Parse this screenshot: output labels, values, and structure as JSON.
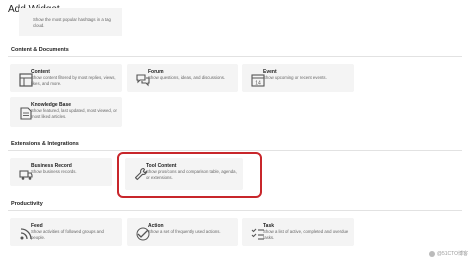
{
  "dialog": {
    "title": "Add Widget"
  },
  "top_partial": {
    "desc": "Show the most popular hashtags in a tag cloud."
  },
  "sections": {
    "content": {
      "label": "Content & Documents"
    },
    "extensions": {
      "label": "Extensions & Integrations"
    },
    "productivity": {
      "label": "Productivity"
    }
  },
  "widgets": {
    "content": {
      "title": "Content",
      "desc": "Show content filtered by most replies, views, likes, and more.",
      "icon": "content-icon"
    },
    "forum": {
      "title": "Forum",
      "desc": "Show questions, ideas, and discussions.",
      "icon": "forum-icon"
    },
    "event": {
      "title": "Event",
      "desc": "Show upcoming or recent events.",
      "icon": "calendar-icon",
      "icon_text": "14"
    },
    "knowledge": {
      "title": "Knowledge Base",
      "desc": "Show featured, last updated, most viewed, or most liked articles.",
      "icon": "book-icon"
    },
    "business": {
      "title": "Business Record",
      "desc": "Show business records.",
      "icon": "truck-icon"
    },
    "tool": {
      "title": "Tool Content",
      "desc": "Show pros/cons and comparison table, agenda, or extensions.",
      "icon": "wrench-icon"
    },
    "feed": {
      "title": "Feed",
      "desc": "Show activities of followed groups and people.",
      "icon": "feed-icon"
    },
    "action": {
      "title": "Action",
      "desc": "Show a set of frequently used actions.",
      "icon": "action-icon"
    },
    "task": {
      "title": "Task",
      "desc": "Show a list of active, completed and overdue tasks.",
      "icon": "task-icon"
    }
  },
  "watermark": {
    "text": "@51CTO博客"
  },
  "colors": {
    "highlight": "#c8262b",
    "card_bg": "#f4f4f4"
  }
}
